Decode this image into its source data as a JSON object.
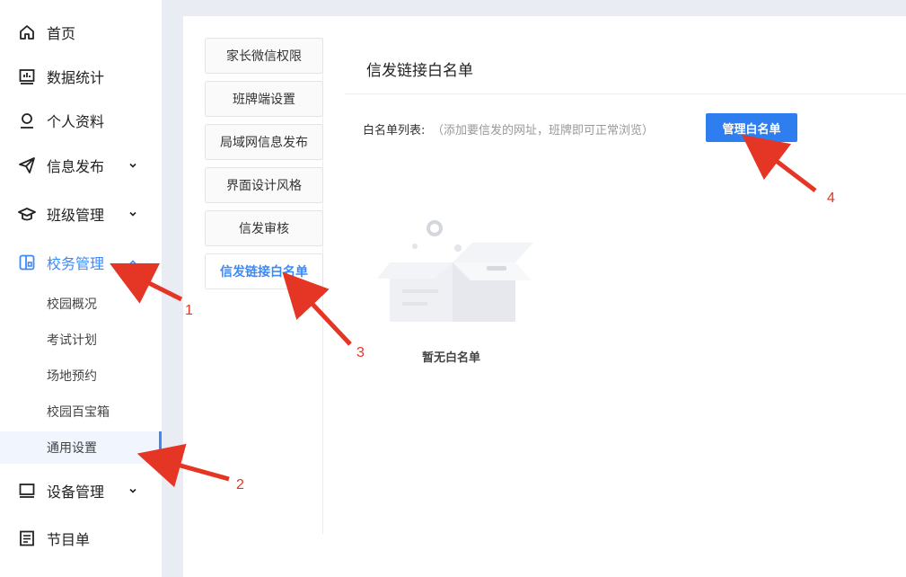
{
  "sidebar": {
    "items": [
      {
        "label": "首页",
        "icon": "home-icon"
      },
      {
        "label": "数据统计",
        "icon": "chart-icon"
      },
      {
        "label": "个人资料",
        "icon": "user-icon"
      },
      {
        "label": "信息发布",
        "icon": "send-icon"
      },
      {
        "label": "班级管理",
        "icon": "graduation-cap-icon"
      },
      {
        "label": "校务管理",
        "icon": "school-affairs-icon"
      },
      {
        "label": "设备管理",
        "icon": "monitor-icon"
      },
      {
        "label": "节目单",
        "icon": "document-icon"
      }
    ],
    "subitems": [
      "校园概况",
      "考试计划",
      "场地预约",
      "校园百宝箱",
      "通用设置"
    ],
    "active_item": "校务管理",
    "selected_subitem": "通用设置",
    "accent_color": "#3d8af7"
  },
  "tabs": [
    "家长微信权限",
    "班牌端设置",
    "局域网信息发布",
    "界面设计风格",
    "信发审核",
    "信发链接白名单"
  ],
  "active_tab": "信发链接白名单",
  "content": {
    "title": "信发链接白名单",
    "whitelist_label": "白名单列表:",
    "whitelist_hint": "（添加要信发的网址，班牌即可正常浏览）",
    "manage_button": "管理白名单",
    "empty_text": "暂无白名单",
    "button_color": "#2f7ef0"
  },
  "annotations": [
    "1",
    "2",
    "3",
    "4"
  ],
  "annotation_color": "#e53525"
}
